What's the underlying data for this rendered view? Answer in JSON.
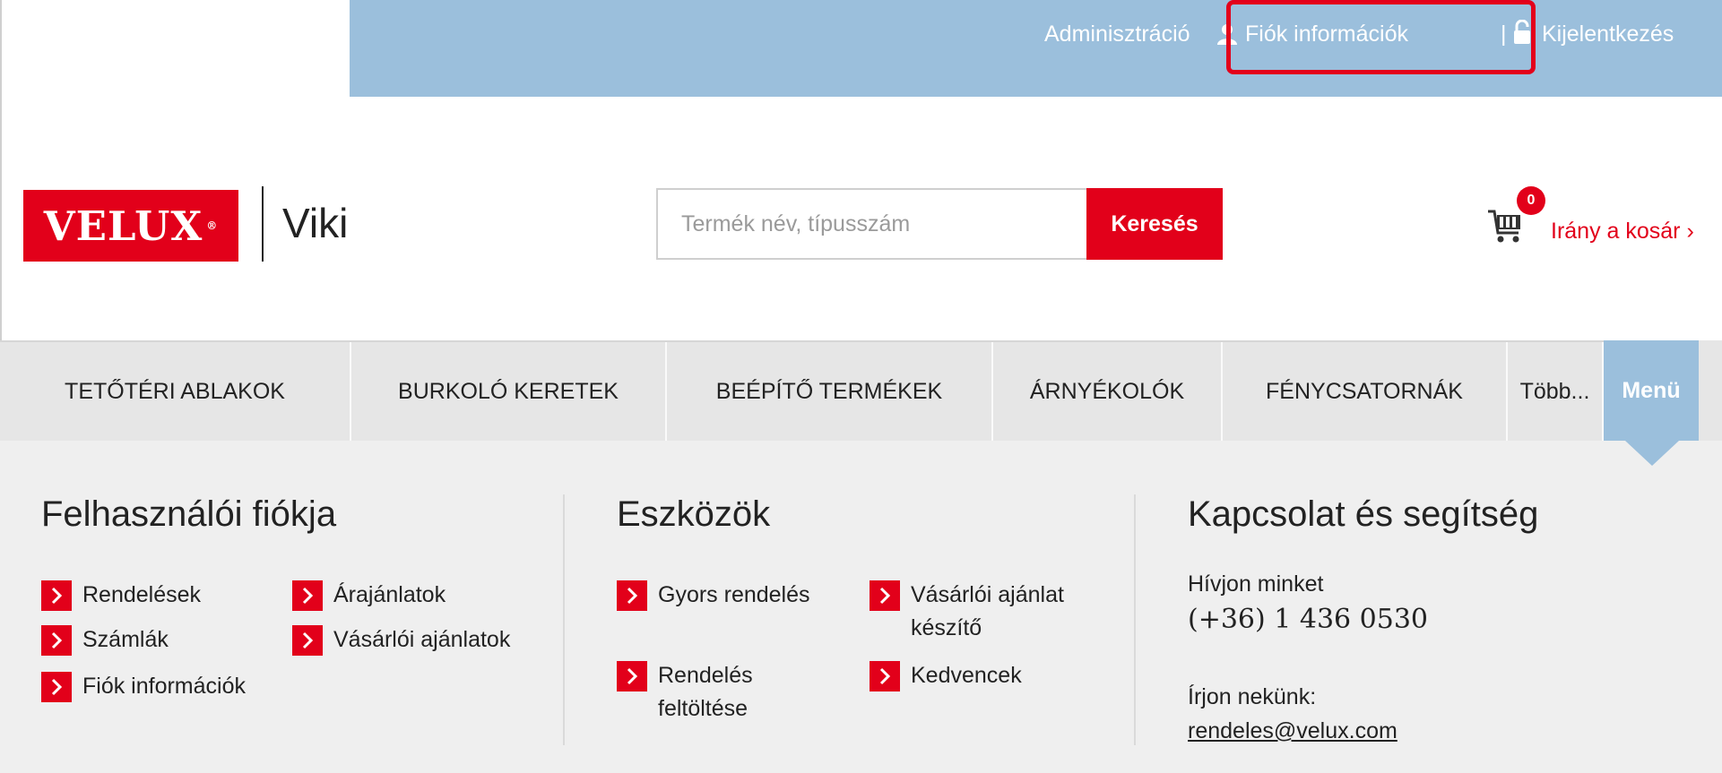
{
  "topbar": {
    "admin_label": "Adminisztráció",
    "account_label": "Fiók információk",
    "separator": "|",
    "logout_label": "Kijelentkezés",
    "highlight_color": "#e3001b"
  },
  "header": {
    "logo_text": "VELUX",
    "logo_mark": "®",
    "site_name": "Viki",
    "search": {
      "placeholder": "Termék név, típusszám",
      "button_label": "Keresés"
    },
    "cart": {
      "count": "0",
      "label": "Irány a kosár ›"
    }
  },
  "nav": {
    "items": [
      {
        "label": "TETŐTÉRI ABLAKOK"
      },
      {
        "label": "BURKOLÓ KERETEK"
      },
      {
        "label": "BEÉPÍTŐ TERMÉKEK"
      },
      {
        "label": "ÁRNYÉKOLÓK"
      },
      {
        "label": "FÉNYCSATORNÁK"
      },
      {
        "label": "Több..."
      }
    ],
    "menu_label": "Menü"
  },
  "panel": {
    "account": {
      "title": "Felhasználói fiókja",
      "links": [
        "Rendelések",
        "Árajánlatok",
        "Számlák",
        "Vásárlói ajánlatok",
        "Fiók információk"
      ]
    },
    "tools": {
      "title": "Eszközök",
      "links": [
        "Gyors rendelés",
        "Vásárlói ajánlat készítő",
        "Rendelés feltöltése",
        "Kedvencek"
      ]
    },
    "contact": {
      "title": "Kapcsolat és segítség",
      "call_label": "Hívjon minket",
      "phone": "(+36) 1 436 0530",
      "write_label": "Írjon nekünk:",
      "email": "rendeles@velux.com"
    }
  },
  "colors": {
    "brand_red": "#e2001a",
    "topbar_blue": "#9bbfdc",
    "nav_gray": "#e6e6e6",
    "panel_gray": "#efefef"
  }
}
